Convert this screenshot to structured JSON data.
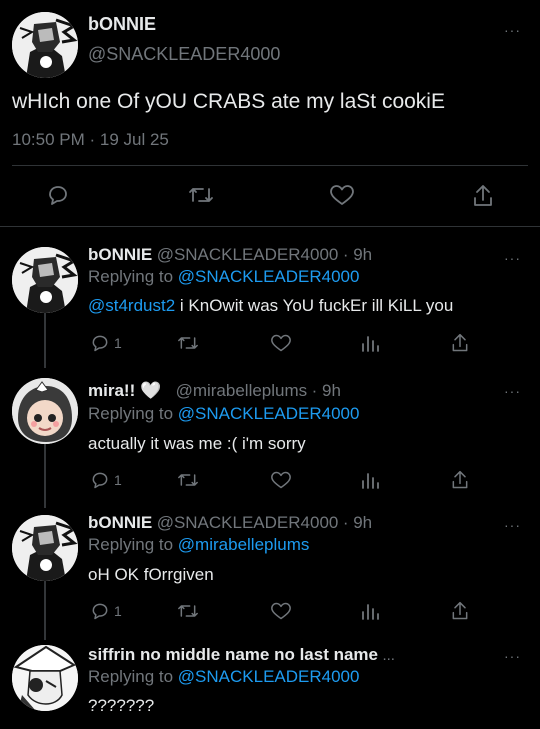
{
  "main_post": {
    "display_name": "bONNIE",
    "handle": "@SNACKLEADER4000",
    "text": "wHIch one Of yOU CRABS ate my laSt cookiE",
    "timestamp": "10:50 PM · 19 Jul 25",
    "more": "···"
  },
  "replies": [
    {
      "display_name": "bONNIE",
      "handle": "@SNACKLEADER4000",
      "time": "· 9h",
      "replying_label": "Replying to",
      "replying_to": "@SNACKLEADER4000",
      "mention": "@st4rdust2",
      "text": " i KnOwit was YoU fuckEr ill KiLL you",
      "reply_count": "1",
      "more": "···"
    },
    {
      "display_name": "mira!! 🤍",
      "handle": "@mirabelleplums",
      "time": "· 9h",
      "replying_label": "Replying to",
      "replying_to": "@SNACKLEADER4000",
      "text": "actually it was me :( i'm sorry",
      "reply_count": "1",
      "more": "···"
    },
    {
      "display_name": "bONNIE",
      "handle": "@SNACKLEADER4000",
      "time": "· 9h",
      "replying_label": "Replying to",
      "replying_to": "@mirabelleplums",
      "text": "oH OK fOrrgiven",
      "reply_count": "1",
      "more": "···"
    },
    {
      "display_name": "siffrin no middle name no last name",
      "name_ellipsis": "...",
      "replying_label": "Replying to",
      "replying_to": "@SNACKLEADER4000",
      "text": "???????",
      "more": "···"
    }
  ],
  "icons": [
    "reply-icon",
    "retweet-icon",
    "like-icon",
    "share-icon",
    "views-icon"
  ],
  "colors": {
    "background": "#000000",
    "text": "#e7e9ea",
    "muted": "#71767b",
    "link": "#1d9bf0",
    "divider": "#2f3336"
  }
}
